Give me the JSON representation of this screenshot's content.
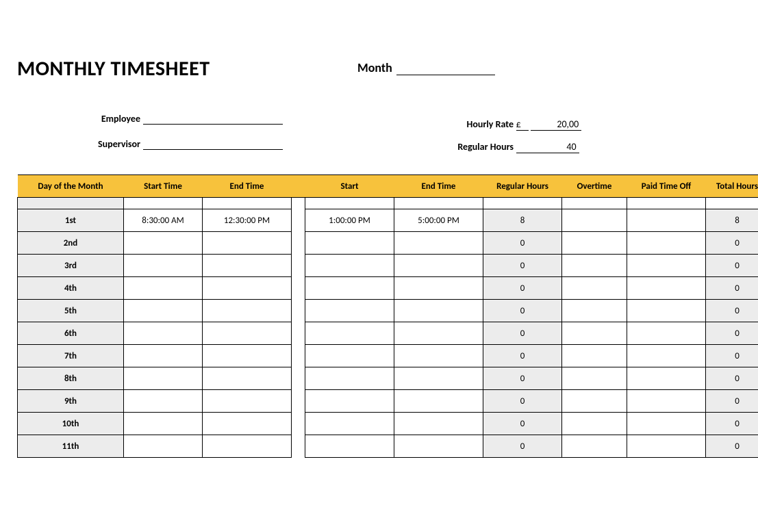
{
  "title": "MONTHLY TIMESHEET",
  "labels": {
    "month": "Month",
    "employee": "Employee",
    "supervisor": "Supervisor",
    "hourly_rate": "Hourly Rate",
    "regular_hours": "Regular Hours",
    "currency": "£"
  },
  "values": {
    "month": "",
    "employee": "",
    "supervisor": "",
    "hourly_rate": "20,00",
    "regular_hours": "40"
  },
  "columns": {
    "day": "Day of the Month",
    "start1": "Start Time",
    "end1": "End Time",
    "start2": "Start",
    "end2": "End Time",
    "regular": "Regular Hours",
    "overtime": "Overtime",
    "pto": "Paid Time Off",
    "total": "Total Hours"
  },
  "rows": [
    {
      "day": "1st",
      "start1": "8:30:00 AM",
      "end1": "12:30:00 PM",
      "start2": "1:00:00 PM",
      "end2": "5:00:00 PM",
      "regular": "8",
      "overtime": "",
      "pto": "",
      "total": "8"
    },
    {
      "day": "2nd",
      "start1": "",
      "end1": "",
      "start2": "",
      "end2": "",
      "regular": "0",
      "overtime": "",
      "pto": "",
      "total": "0"
    },
    {
      "day": "3rd",
      "start1": "",
      "end1": "",
      "start2": "",
      "end2": "",
      "regular": "0",
      "overtime": "",
      "pto": "",
      "total": "0"
    },
    {
      "day": "4th",
      "start1": "",
      "end1": "",
      "start2": "",
      "end2": "",
      "regular": "0",
      "overtime": "",
      "pto": "",
      "total": "0"
    },
    {
      "day": "5th",
      "start1": "",
      "end1": "",
      "start2": "",
      "end2": "",
      "regular": "0",
      "overtime": "",
      "pto": "",
      "total": "0"
    },
    {
      "day": "6th",
      "start1": "",
      "end1": "",
      "start2": "",
      "end2": "",
      "regular": "0",
      "overtime": "",
      "pto": "",
      "total": "0"
    },
    {
      "day": "7th",
      "start1": "",
      "end1": "",
      "start2": "",
      "end2": "",
      "regular": "0",
      "overtime": "",
      "pto": "",
      "total": "0"
    },
    {
      "day": "8th",
      "start1": "",
      "end1": "",
      "start2": "",
      "end2": "",
      "regular": "0",
      "overtime": "",
      "pto": "",
      "total": "0"
    },
    {
      "day": "9th",
      "start1": "",
      "end1": "",
      "start2": "",
      "end2": "",
      "regular": "0",
      "overtime": "",
      "pto": "",
      "total": "0"
    },
    {
      "day": "10th",
      "start1": "",
      "end1": "",
      "start2": "",
      "end2": "",
      "regular": "0",
      "overtime": "",
      "pto": "",
      "total": "0"
    },
    {
      "day": "11th",
      "start1": "",
      "end1": "",
      "start2": "",
      "end2": "",
      "regular": "0",
      "overtime": "",
      "pto": "",
      "total": "0"
    }
  ]
}
